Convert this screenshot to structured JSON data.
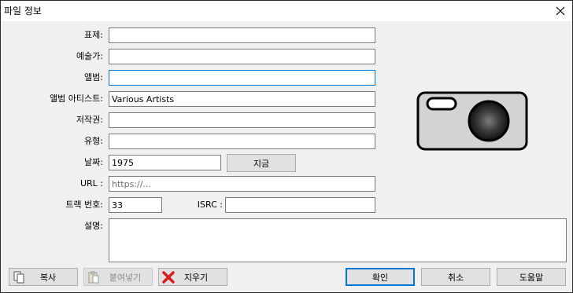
{
  "window": {
    "title": "파일 정보"
  },
  "labels": {
    "title": "표제:",
    "artist": "예술가:",
    "album": "앨범:",
    "album_artist": "앨범 아티스트:",
    "copyright": "저작권:",
    "genre": "유형:",
    "date": "날짜:",
    "url": "URL :",
    "track": "트랙 번호:",
    "isrc": "ISRC :",
    "description": "설명:"
  },
  "fields": {
    "title": "",
    "artist": "",
    "album": "",
    "album_artist": "Various Artists",
    "copyright": "",
    "genre": "",
    "date": "1975",
    "url_placeholder": "https://...",
    "track": "33",
    "isrc": "",
    "description": ""
  },
  "buttons": {
    "now": "지금",
    "copy": "복사",
    "paste": "붙여넣기",
    "clear": "지우기",
    "ok": "확인",
    "cancel": "취소",
    "help": "도움말"
  },
  "icons": {
    "close": "close-icon",
    "copy": "copy-icon",
    "paste": "paste-icon",
    "clear": "red-x-icon",
    "artwork": "camera-icon"
  },
  "colors": {
    "focus": "#0078d7",
    "clear_icon": "#d81e1e",
    "camera_body": "#d3d3d3"
  }
}
